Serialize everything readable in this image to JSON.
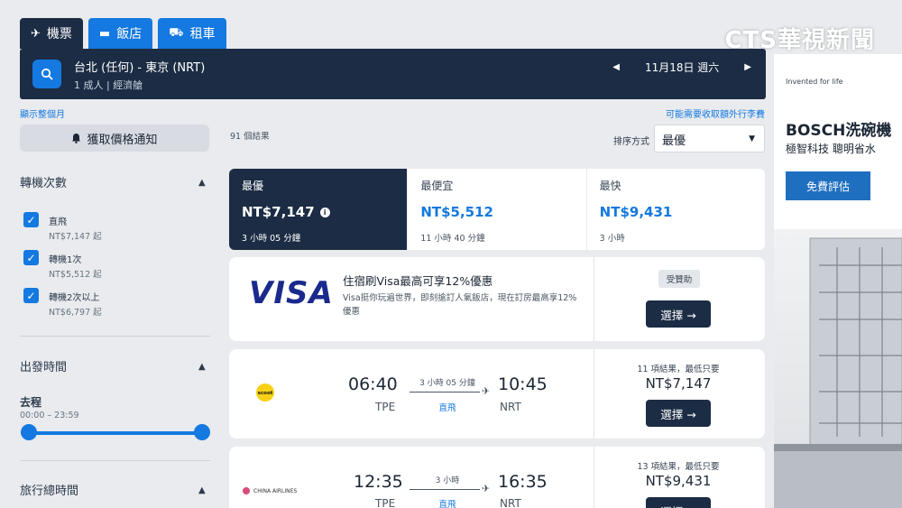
{
  "tabs": [
    {
      "icon": "plane-icon",
      "glyph": "✈",
      "label": "機票",
      "active": true
    },
    {
      "icon": "bed-icon",
      "glyph": "▬",
      "label": "飯店",
      "active": false
    },
    {
      "icon": "car-icon",
      "glyph": "⛟",
      "label": "租車",
      "active": false
    }
  ],
  "watermark": {
    "text": "CTS華視新聞",
    "small": "新聞"
  },
  "search": {
    "route": "台北 (任何) - 東京 (NRT)",
    "passengers": "1 成人 | 經濟艙",
    "date": "11月18日 週六"
  },
  "links": {
    "show_month": "顯示整個月",
    "bag_fee": "可能需要收取額外行李費"
  },
  "sidebar": {
    "alert_button": "獲取價格通知",
    "stops_title": "轉機次數",
    "stops": [
      {
        "label": "直飛",
        "price": "NT$7,147 起",
        "checked": true
      },
      {
        "label": "轉機1次",
        "price": "NT$5,512 起",
        "checked": true
      },
      {
        "label": "轉機2次以上",
        "price": "NT$6,797 起",
        "checked": true
      }
    ],
    "departure_title": "出發時間",
    "outbound_label": "去程",
    "outbound_range": "00:00 – 23:59",
    "duration_title": "旅行總時間"
  },
  "results": {
    "count": "91 個結果",
    "sort_label": "排序方式",
    "sort_value": "最優"
  },
  "sort_cards": [
    {
      "title": "最優",
      "price": "NT$7,147",
      "duration": "3 小時 05 分鐘",
      "active": true
    },
    {
      "title": "最便宜",
      "price": "NT$5,512",
      "duration": "11 小時 40 分鐘",
      "active": false
    },
    {
      "title": "最快",
      "price": "NT$9,431",
      "duration": "3 小時",
      "active": false
    }
  ],
  "promo": {
    "logo": "VISA",
    "title": "住宿刷Visa最高可享12%優惠",
    "desc": "Visa挺你玩遍世界，即刻搶訂人氣飯店，現在訂房最高享12%優惠",
    "sponsored": "受贊助",
    "button": "選擇 →"
  },
  "flights": [
    {
      "airline": "scoot",
      "dep_time": "06:40",
      "dep_apt": "TPE",
      "arr_time": "10:45",
      "arr_apt": "NRT",
      "duration": "3 小時 05 分鐘",
      "stops": "直飛",
      "deals": "11 項結果，最低只要",
      "price": "NT$7,147",
      "button": "選擇 →"
    },
    {
      "airline": "CHINA AIRLINES",
      "dep_time": "12:35",
      "dep_apt": "TPE",
      "arr_time": "16:35",
      "arr_apt": "NRT",
      "duration": "3 小時",
      "stops": "直飛",
      "deals": "13 項結果，最低只要",
      "price": "NT$9,431",
      "button": "選擇 →"
    }
  ],
  "ad": {
    "tag": "Invented for life",
    "brand": "BOSCH洗碗機",
    "slogan": "極智科技 聰明省水",
    "cta": "免費評估"
  },
  "colors": {
    "navy": "#1b2c44",
    "accent": "#1479e0",
    "visa": "#1a2a8c"
  }
}
